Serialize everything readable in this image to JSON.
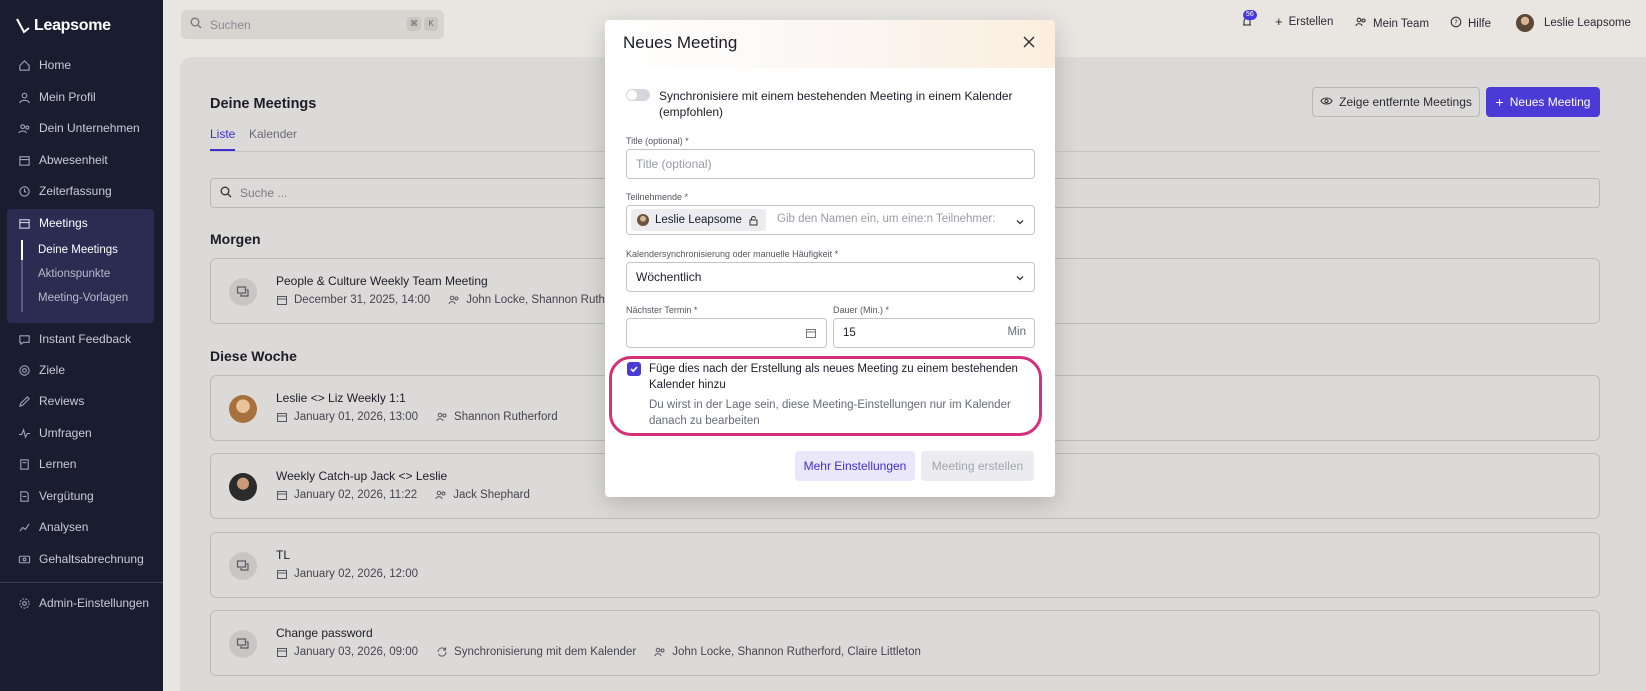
{
  "app": {
    "logo": "Leapsome"
  },
  "sidebar": {
    "items": [
      {
        "label": "Home",
        "icon": "home-icon"
      },
      {
        "label": "Mein Profil",
        "icon": "user-icon"
      },
      {
        "label": "Dein Unternehmen",
        "icon": "company-icon"
      },
      {
        "label": "Abwesenheit",
        "icon": "calendar-icon"
      },
      {
        "label": "Zeiterfassung",
        "icon": "clock-icon"
      },
      {
        "label": "Meetings",
        "icon": "meetings-icon"
      },
      {
        "label": "Instant Feedback",
        "icon": "feedback-icon"
      },
      {
        "label": "Ziele",
        "icon": "target-icon"
      },
      {
        "label": "Reviews",
        "icon": "pen-icon"
      },
      {
        "label": "Umfragen",
        "icon": "pulse-icon"
      },
      {
        "label": "Lernen",
        "icon": "book-icon"
      },
      {
        "label": "Vergütung",
        "icon": "compensation-icon"
      },
      {
        "label": "Analysen",
        "icon": "chart-icon"
      },
      {
        "label": "Gehaltsabrechnung",
        "icon": "payroll-icon"
      },
      {
        "label": "Admin-Einstellungen",
        "icon": "gear-icon"
      }
    ],
    "meetings_sub": [
      "Deine Meetings",
      "Aktionspunkte",
      "Meeting-Vorlagen"
    ]
  },
  "topbar": {
    "search_placeholder": "Suchen",
    "kbd": [
      "⌘",
      "K"
    ],
    "notifications_count": "56",
    "create": "Erstellen",
    "team": "Mein Team",
    "help": "Hilfe",
    "user": "Leslie Leapsome"
  },
  "main": {
    "title": "Deine Meetings",
    "tabs": [
      "Liste",
      "Kalender"
    ],
    "show_removed": "Zeige entfernte Meetings",
    "new_meeting": "Neues Meeting",
    "search_placeholder": "Suche ...",
    "sections": {
      "tomorrow": "Morgen",
      "this_week": "Diese Woche"
    },
    "meetings": [
      {
        "title": "People & Culture Weekly Team Meeting",
        "date": "December 31, 2025, 14:00",
        "participants": "John Locke, Shannon Rutherford"
      },
      {
        "title": "Leslie <> Liz Weekly 1:1",
        "date": "January 01, 2026, 13:00",
        "participants": "Shannon Rutherford"
      },
      {
        "title": "Weekly Catch-up Jack <> Leslie",
        "date": "January 02, 2026, 11:22",
        "participants": "Jack Shephard"
      },
      {
        "title": "TL",
        "date": "January 02, 2026, 12:00",
        "participants": ""
      },
      {
        "title": "Change password",
        "date": "January 03, 2026, 09:00",
        "sync": "Synchronisierung mit dem Kalender",
        "participants": "John Locke, Shannon Rutherford, Claire Littleton"
      }
    ]
  },
  "modal": {
    "title": "Neues Meeting",
    "sync_label": "Synchronisiere mit einem bestehenden Meeting in einem Kalender (empfohlen)",
    "title_label": "Title (optional) *",
    "title_placeholder": "Title (optional)",
    "participants_label": "Teilnehmende *",
    "participant_chip": "Leslie Leapsome",
    "participants_placeholder": "Gib den Namen ein, um eine:n Teilnehmer:in",
    "frequency_label": "Kalendersynchronisierung oder manuelle Häufigkeit *",
    "frequency_value": "Wöchentlich",
    "next_date_label": "Nächster Termin *",
    "duration_label": "Dauer (Min.) *",
    "duration_value": "15",
    "duration_unit": "Min",
    "add_to_calendar_label": "Füge dies nach der Erstellung als neues Meeting zu einem bestehenden Kalender hinzu",
    "add_to_calendar_help": "Du wirst in der Lage sein, diese Meeting-Einstellungen nur im Kalender danach zu bearbeiten",
    "more_settings": "Mehr Einstellungen",
    "create": "Meeting erstellen"
  },
  "colors": {
    "accent": "#4a3ad6",
    "highlight": "#d4317a",
    "sidebar": "#1a1d30"
  }
}
